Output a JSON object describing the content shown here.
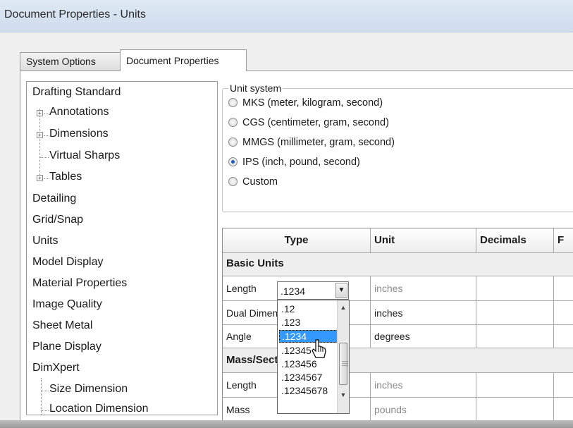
{
  "window": {
    "title": "Document Properties - Units"
  },
  "tabs": [
    {
      "label": "System Options",
      "active": false
    },
    {
      "label": "Document Properties",
      "active": true
    }
  ],
  "tree": {
    "items": [
      {
        "label": "Drafting Standard",
        "level": 0,
        "expander": ""
      },
      {
        "label": "Annotations",
        "level": 1,
        "expander": "+"
      },
      {
        "label": "Dimensions",
        "level": 1,
        "expander": "+"
      },
      {
        "label": "Virtual Sharps",
        "level": 1,
        "expander": ""
      },
      {
        "label": "Tables",
        "level": 1,
        "expander": "+"
      },
      {
        "label": "Detailing",
        "level": 0,
        "expander": ""
      },
      {
        "label": "Grid/Snap",
        "level": 0,
        "expander": ""
      },
      {
        "label": "Units",
        "level": 0,
        "expander": "",
        "selected": true
      },
      {
        "label": "Model Display",
        "level": 0,
        "expander": ""
      },
      {
        "label": "Material Properties",
        "level": 0,
        "expander": ""
      },
      {
        "label": "Image Quality",
        "level": 0,
        "expander": ""
      },
      {
        "label": "Sheet Metal",
        "level": 0,
        "expander": ""
      },
      {
        "label": "Plane Display",
        "level": 0,
        "expander": ""
      },
      {
        "label": "DimXpert",
        "level": 0,
        "expander": ""
      },
      {
        "label": "Size Dimension",
        "level": 1,
        "expander": ""
      },
      {
        "label": "Location Dimension",
        "level": 1,
        "expander": ""
      }
    ]
  },
  "unit_system": {
    "label": "Unit system",
    "options": [
      {
        "label": "MKS  (meter, kilogram, second)",
        "checked": false
      },
      {
        "label": "CGS  (centimeter, gram, second)",
        "checked": false
      },
      {
        "label": "MMGS (millimeter, gram, second)",
        "checked": false
      },
      {
        "label": "IPS  (inch, pound, second)",
        "checked": true
      },
      {
        "label": "Custom",
        "checked": false
      }
    ]
  },
  "table": {
    "headers": {
      "type": "Type",
      "unit": "Unit",
      "decimals": "Decimals",
      "fractions": "F"
    },
    "sections": {
      "basic": "Basic Units",
      "mass": "Mass/Section Properties"
    },
    "rows": {
      "length": {
        "type": "Length",
        "unit": "inches"
      },
      "dual": {
        "type": "Dual Dimension Length",
        "unit": "inches"
      },
      "angle": {
        "type": "Angle",
        "unit": "degrees"
      },
      "mass_length": {
        "type": "Length",
        "unit": "inches"
      },
      "mass": {
        "type": "Mass",
        "unit": "pounds"
      }
    }
  },
  "decimals_combo": {
    "value": ".1234",
    "options": [
      ".12",
      ".123",
      ".1234",
      ".12345",
      ".123456",
      ".1234567",
      ".12345678"
    ],
    "highlighted": ".1234"
  },
  "colors": {
    "selection": "#3399ff",
    "radio_dot": "#1f55b8",
    "title_bg": "#cfdcec"
  },
  "icons": {
    "expander": "plus-box-icon",
    "combo_arrow": "chevron-down-icon",
    "cursor": "mouse-pointer-icon"
  }
}
